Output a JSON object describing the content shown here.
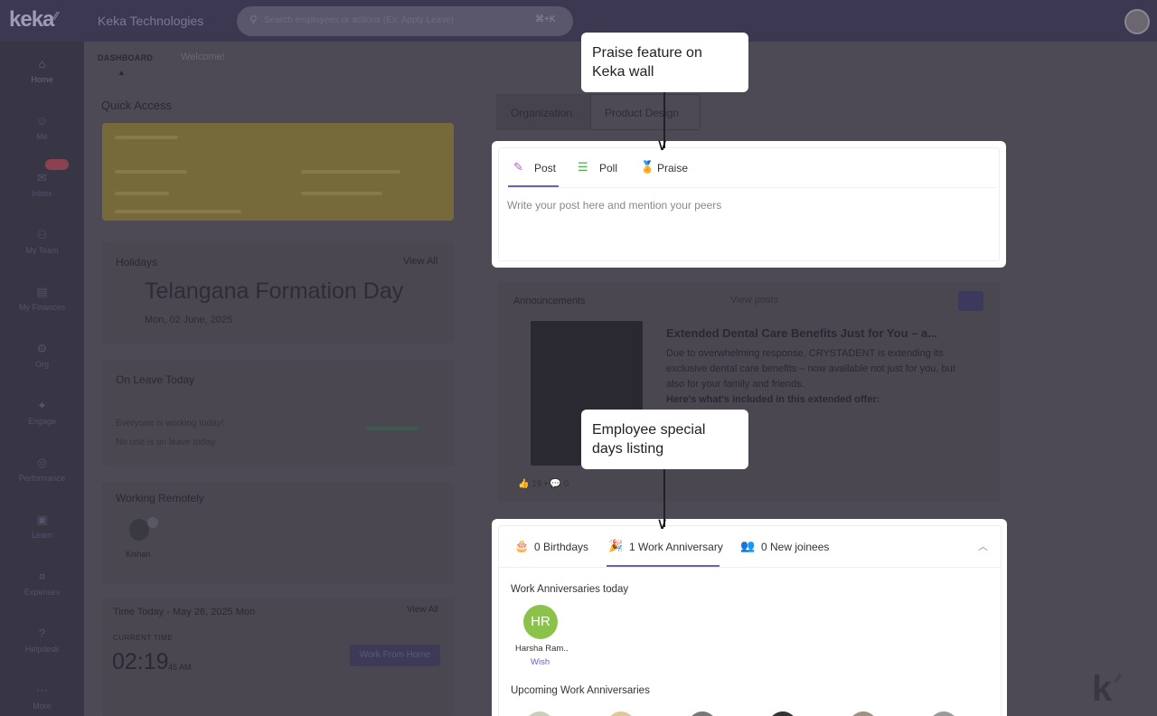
{
  "topbar": {
    "logo": "keka",
    "company": "Keka Technologies",
    "search_placeholder": "Search employees or actions (Ex: Apply Leave)",
    "search_shortcut": "⌘+K"
  },
  "sidebar": {
    "items": [
      {
        "icon": "home-icon",
        "label": "Home"
      },
      {
        "icon": "me-icon",
        "label": "Me"
      },
      {
        "icon": "inbox-icon",
        "label": "Inbox"
      },
      {
        "icon": "myteam-icon",
        "label": "My Team"
      },
      {
        "icon": "finances-icon",
        "label": "My Finances"
      },
      {
        "icon": "org-icon",
        "label": "Org"
      },
      {
        "icon": "engage-icon",
        "label": "Engage"
      },
      {
        "icon": "performance-icon",
        "label": "Performance"
      },
      {
        "icon": "learn-icon",
        "label": "Learn"
      },
      {
        "icon": "expenses-icon",
        "label": "Expenses"
      },
      {
        "icon": "helpdesk-icon",
        "label": "Helpdesk"
      },
      {
        "icon": "more-icon",
        "label": "More"
      }
    ]
  },
  "subnav": {
    "dashboard": "DASHBOARD",
    "welcome": "Welcome!"
  },
  "left": {
    "quick_access": "Quick Access",
    "holidays_title": "Holidays",
    "holidays_viewall": "View All",
    "holiday_name": "Telangana Formation Day",
    "holiday_date": "Mon, 02 June, 2025",
    "leave_title": "On Leave Today",
    "leave_line1": "Everyone is working today!",
    "leave_line2": "No one is on leave today.",
    "remote_title": "Working Remotely",
    "remote_name": "Kishan",
    "time_title": "Time Today - May 26, 2025 Mon",
    "time_viewall": "View All",
    "current_time_label": "CURRENT TIME",
    "current_time": "02:19",
    "current_sec": "45 AM",
    "wfh_button": "Work From Home"
  },
  "org_tabs": {
    "org": "Organization",
    "product": "Product Design"
  },
  "post": {
    "tabs": [
      {
        "icon": "pencil-icon",
        "label": "Post"
      },
      {
        "icon": "poll-icon",
        "label": "Poll"
      },
      {
        "icon": "medal-icon",
        "label": "Praise"
      }
    ],
    "placeholder": "Write your post here and mention your peers"
  },
  "announcements": {
    "title": "Announcements",
    "view": "View posts",
    "headline": "Extended Dental Care Benefits Just for You – a...",
    "body1": "Due to overwhelming response, CRYSTADENT is extending its exclusive dental care benefits – now available not just for you, but also for your family and friends.",
    "body2": "Here's what's included in this extended offer:",
    "footer": "👍 19 • 💬 0"
  },
  "special_days": {
    "tabs": [
      {
        "icon": "cake-icon",
        "label": "0 Birthdays"
      },
      {
        "icon": "party-icon",
        "label": "1 Work Anniversary"
      },
      {
        "icon": "people-icon",
        "label": "0 New joinees"
      }
    ],
    "today_title": "Work Anniversaries today",
    "person_initials": "HR",
    "person_name": "Harsha Ram..",
    "wish": "Wish",
    "upcoming_title": "Upcoming Work Anniversaries"
  },
  "callouts": {
    "praise": "Praise feature on Keka wall",
    "special": "Employee special days listing"
  },
  "colors": {
    "accent": "#6b5fc0",
    "avatar_hr": "#8bc34a"
  }
}
